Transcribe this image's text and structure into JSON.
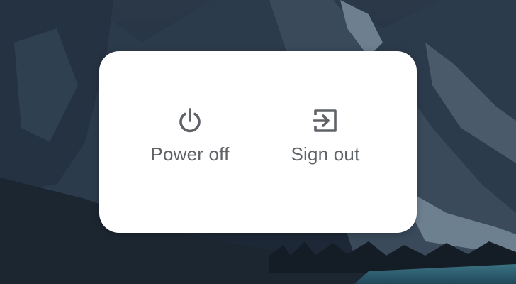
{
  "power_menu": {
    "items": [
      {
        "label": "Power off",
        "icon": "power-icon"
      },
      {
        "label": "Sign out",
        "icon": "sign-out-icon"
      }
    ]
  },
  "colors": {
    "dialog_background": "#ffffff",
    "label_text": "#5f6368",
    "icon": "#5f6368",
    "wallpaper_dark": "#1f2b3a",
    "lake": "#2e5d6d"
  }
}
